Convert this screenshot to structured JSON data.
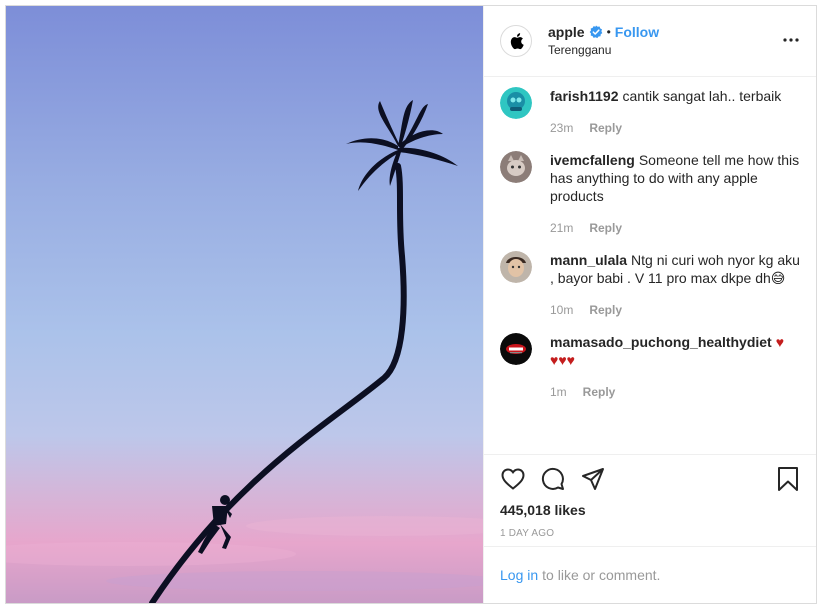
{
  "post": {
    "username": "apple",
    "verified": true,
    "follow_label": "Follow",
    "separator": "•",
    "location": "Terengganu",
    "more_icon": "more-horizontal-icon"
  },
  "comments": [
    {
      "user": "farish1192",
      "text": "cantik sangat lah.. terbaik",
      "time": "23m",
      "reply": "Reply"
    },
    {
      "user": "ivemcfalleng",
      "text": "Someone tell me how this has anything to do with any apple products",
      "time": "21m",
      "reply": "Reply"
    },
    {
      "user": "mann_ulala",
      "text": "Ntg ni curi woh nyor kg aku , bayor babi . V 11 pro max dkpe dh😅",
      "time": "10m",
      "reply": "Reply"
    },
    {
      "user": "mamasado_puchong_healthydiet",
      "text": "",
      "hearts": "♥ ♥♥♥",
      "time": "1m",
      "reply": "Reply"
    }
  ],
  "actions": {
    "like_icon": "heart-outline-icon",
    "comment_icon": "comment-bubble-icon",
    "share_icon": "paper-plane-icon",
    "save_icon": "bookmark-icon",
    "likes": "445,018 likes",
    "date": "1 DAY AGO"
  },
  "login": {
    "link": "Log in",
    "text": "to like or comment."
  },
  "colors": {
    "accent": "#3897f0",
    "text": "#262626",
    "muted": "#999999",
    "border": "#dbdbdb",
    "heart": "#c41d1d"
  }
}
